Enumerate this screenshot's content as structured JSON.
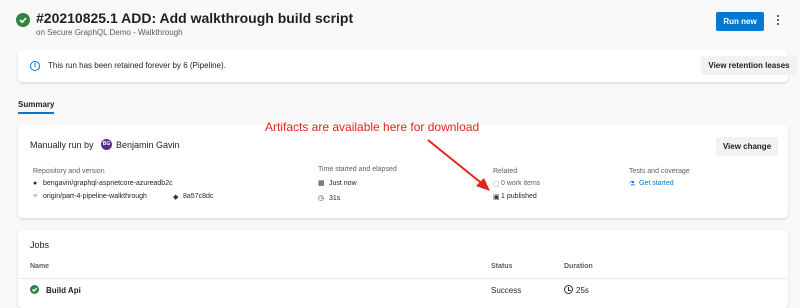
{
  "header": {
    "title": "#20210825.1 ADD: Add walkthrough build script",
    "subtitle": "on Secure GraphQL Demo - Walkthrough",
    "run_new_label": "Run new"
  },
  "retention": {
    "message": "This run has been retained forever by 6 (Pipeline).",
    "button_label": "View retention leases"
  },
  "tabs": {
    "summary_label": "Summary"
  },
  "summary": {
    "manual_label": "Manually run by",
    "avatar_initials": "BG",
    "user_name": "Benjamin Gavin",
    "view_change_label": "View change",
    "repo_heading": "Repository and version",
    "repo_name": "bengavin/graphql-aspnetcore-azureadb2c",
    "branch": "origin/part-4-pipeline-walkthrough",
    "commit": "8a57c8dc",
    "time_heading": "Time started and elapsed",
    "started": "Just now",
    "elapsed": "31s",
    "related_heading": "Related",
    "work_items": "0 work items",
    "published": "1 published",
    "tests_heading": "Tests and coverage",
    "tests_link": "Get started"
  },
  "annotation": {
    "text": "Artifacts are available here for download",
    "color": "#e8231b"
  },
  "jobs": {
    "title": "Jobs",
    "columns": [
      "Name",
      "Status",
      "Duration"
    ],
    "rows": [
      {
        "name": "Build Api",
        "status": "Success",
        "duration": "25s"
      }
    ]
  },
  "colors": {
    "accent": "#0078d4",
    "success": "#2e8540"
  }
}
